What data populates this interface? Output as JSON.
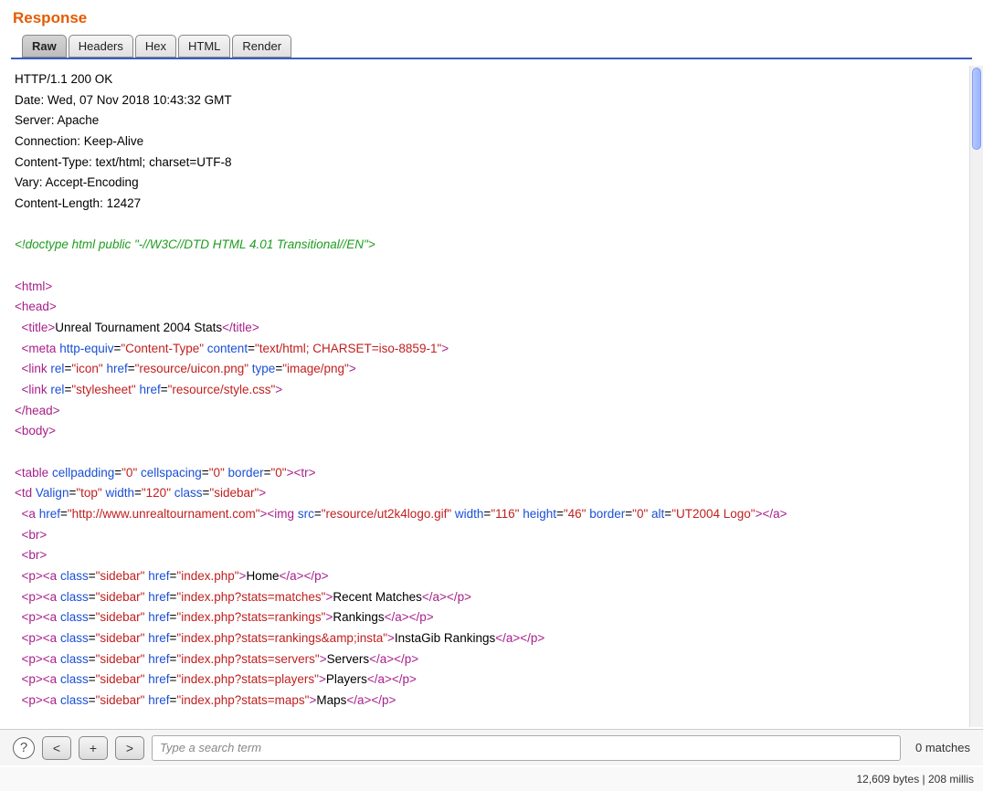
{
  "header": {
    "title": "Response"
  },
  "tabs": [
    {
      "label": "Raw",
      "active": true
    },
    {
      "label": "Headers",
      "active": false
    },
    {
      "label": "Hex",
      "active": false
    },
    {
      "label": "HTML",
      "active": false
    },
    {
      "label": "Render",
      "active": false
    }
  ],
  "http_headers": [
    "HTTP/1.1 200 OK",
    "Date: Wed, 07 Nov 2018 10:43:32 GMT",
    "Server: Apache",
    "Connection: Keep-Alive",
    "Content-Type: text/html; charset=UTF-8",
    "Vary: Accept-Encoding",
    "Content-Length: 12427"
  ],
  "doctype": "<!doctype html public \"-//W3C//DTD HTML 4.01 Transitional//EN\">",
  "body_tokens": [
    [
      {
        "c": "tg",
        "t": "<html>"
      }
    ],
    [
      {
        "c": "tg",
        "t": "<head>"
      }
    ],
    [
      {
        "c": "tx",
        "t": "  "
      },
      {
        "c": "tg",
        "t": "<title>"
      },
      {
        "c": "tx",
        "t": "Unreal Tournament 2004 Stats"
      },
      {
        "c": "tg",
        "t": "</title>"
      }
    ],
    [
      {
        "c": "tx",
        "t": "  "
      },
      {
        "c": "tg",
        "t": "<meta"
      },
      {
        "c": "tx",
        "t": " "
      },
      {
        "c": "at",
        "t": "http-equiv"
      },
      {
        "c": "tx",
        "t": "="
      },
      {
        "c": "av",
        "t": "\"Content-Type\""
      },
      {
        "c": "tx",
        "t": " "
      },
      {
        "c": "at",
        "t": "content"
      },
      {
        "c": "tx",
        "t": "="
      },
      {
        "c": "av",
        "t": "\"text/html; CHARSET=iso-8859-1\""
      },
      {
        "c": "tg",
        "t": ">"
      }
    ],
    [
      {
        "c": "tx",
        "t": "  "
      },
      {
        "c": "tg",
        "t": "<link"
      },
      {
        "c": "tx",
        "t": " "
      },
      {
        "c": "at",
        "t": "rel"
      },
      {
        "c": "tx",
        "t": "="
      },
      {
        "c": "av",
        "t": "\"icon\""
      },
      {
        "c": "tx",
        "t": " "
      },
      {
        "c": "at",
        "t": "href"
      },
      {
        "c": "tx",
        "t": "="
      },
      {
        "c": "av",
        "t": "\"resource/uicon.png\""
      },
      {
        "c": "tx",
        "t": " "
      },
      {
        "c": "at",
        "t": "type"
      },
      {
        "c": "tx",
        "t": "="
      },
      {
        "c": "av",
        "t": "\"image/png\""
      },
      {
        "c": "tg",
        "t": ">"
      }
    ],
    [
      {
        "c": "tx",
        "t": "  "
      },
      {
        "c": "tg",
        "t": "<link"
      },
      {
        "c": "tx",
        "t": " "
      },
      {
        "c": "at",
        "t": "rel"
      },
      {
        "c": "tx",
        "t": "="
      },
      {
        "c": "av",
        "t": "\"stylesheet\""
      },
      {
        "c": "tx",
        "t": " "
      },
      {
        "c": "at",
        "t": "href"
      },
      {
        "c": "tx",
        "t": "="
      },
      {
        "c": "av",
        "t": "\"resource/style.css\""
      },
      {
        "c": "tg",
        "t": ">"
      }
    ],
    [
      {
        "c": "tg",
        "t": "</head>"
      }
    ],
    [
      {
        "c": "tg",
        "t": "<body>"
      }
    ],
    [
      {
        "c": "tx",
        "t": ""
      }
    ],
    [
      {
        "c": "tg",
        "t": "<table"
      },
      {
        "c": "tx",
        "t": " "
      },
      {
        "c": "at",
        "t": "cellpadding"
      },
      {
        "c": "tx",
        "t": "="
      },
      {
        "c": "av",
        "t": "\"0\""
      },
      {
        "c": "tx",
        "t": " "
      },
      {
        "c": "at",
        "t": "cellspacing"
      },
      {
        "c": "tx",
        "t": "="
      },
      {
        "c": "av",
        "t": "\"0\""
      },
      {
        "c": "tx",
        "t": " "
      },
      {
        "c": "at",
        "t": "border"
      },
      {
        "c": "tx",
        "t": "="
      },
      {
        "c": "av",
        "t": "\"0\""
      },
      {
        "c": "tg",
        "t": "><tr>"
      }
    ],
    [
      {
        "c": "tg",
        "t": "<td"
      },
      {
        "c": "tx",
        "t": " "
      },
      {
        "c": "at",
        "t": "Valign"
      },
      {
        "c": "tx",
        "t": "="
      },
      {
        "c": "av",
        "t": "\"top\""
      },
      {
        "c": "tx",
        "t": " "
      },
      {
        "c": "at",
        "t": "width"
      },
      {
        "c": "tx",
        "t": "="
      },
      {
        "c": "av",
        "t": "\"120\""
      },
      {
        "c": "tx",
        "t": " "
      },
      {
        "c": "at",
        "t": "class"
      },
      {
        "c": "tx",
        "t": "="
      },
      {
        "c": "av",
        "t": "\"sidebar\""
      },
      {
        "c": "tg",
        "t": ">"
      }
    ],
    [
      {
        "c": "tx",
        "t": "  "
      },
      {
        "c": "tg",
        "t": "<a"
      },
      {
        "c": "tx",
        "t": " "
      },
      {
        "c": "at",
        "t": "href"
      },
      {
        "c": "tx",
        "t": "="
      },
      {
        "c": "av",
        "t": "\"http://www.unrealtournament.com\""
      },
      {
        "c": "tg",
        "t": "><img"
      },
      {
        "c": "tx",
        "t": " "
      },
      {
        "c": "at",
        "t": "src"
      },
      {
        "c": "tx",
        "t": "="
      },
      {
        "c": "av",
        "t": "\"resource/ut2k4logo.gif\""
      },
      {
        "c": "tx",
        "t": " "
      },
      {
        "c": "at",
        "t": "width"
      },
      {
        "c": "tx",
        "t": "="
      },
      {
        "c": "av",
        "t": "\"116\""
      },
      {
        "c": "tx",
        "t": " "
      },
      {
        "c": "at",
        "t": "height"
      },
      {
        "c": "tx",
        "t": "="
      },
      {
        "c": "av",
        "t": "\"46\""
      },
      {
        "c": "tx",
        "t": " "
      },
      {
        "c": "at",
        "t": "border"
      },
      {
        "c": "tx",
        "t": "="
      },
      {
        "c": "av",
        "t": "\"0\""
      },
      {
        "c": "tx",
        "t": " "
      },
      {
        "c": "at",
        "t": "alt"
      },
      {
        "c": "tx",
        "t": "="
      },
      {
        "c": "av",
        "t": "\"UT2004 Logo\""
      },
      {
        "c": "tg",
        "t": "></a>"
      }
    ],
    [
      {
        "c": "tx",
        "t": "  "
      },
      {
        "c": "tg",
        "t": "<br>"
      }
    ],
    [
      {
        "c": "tx",
        "t": "  "
      },
      {
        "c": "tg",
        "t": "<br>"
      }
    ],
    [
      {
        "c": "tx",
        "t": "  "
      },
      {
        "c": "tg",
        "t": "<p><a"
      },
      {
        "c": "tx",
        "t": " "
      },
      {
        "c": "at",
        "t": "class"
      },
      {
        "c": "tx",
        "t": "="
      },
      {
        "c": "av",
        "t": "\"sidebar\""
      },
      {
        "c": "tx",
        "t": " "
      },
      {
        "c": "at",
        "t": "href"
      },
      {
        "c": "tx",
        "t": "="
      },
      {
        "c": "av",
        "t": "\"index.php\""
      },
      {
        "c": "tg",
        "t": ">"
      },
      {
        "c": "tx",
        "t": "Home"
      },
      {
        "c": "tg",
        "t": "</a></p>"
      }
    ],
    [
      {
        "c": "tx",
        "t": "  "
      },
      {
        "c": "tg",
        "t": "<p><a"
      },
      {
        "c": "tx",
        "t": " "
      },
      {
        "c": "at",
        "t": "class"
      },
      {
        "c": "tx",
        "t": "="
      },
      {
        "c": "av",
        "t": "\"sidebar\""
      },
      {
        "c": "tx",
        "t": " "
      },
      {
        "c": "at",
        "t": "href"
      },
      {
        "c": "tx",
        "t": "="
      },
      {
        "c": "av",
        "t": "\"index.php?stats=matches\""
      },
      {
        "c": "tg",
        "t": ">"
      },
      {
        "c": "tx",
        "t": "Recent Matches"
      },
      {
        "c": "tg",
        "t": "</a></p>"
      }
    ],
    [
      {
        "c": "tx",
        "t": "  "
      },
      {
        "c": "tg",
        "t": "<p><a"
      },
      {
        "c": "tx",
        "t": " "
      },
      {
        "c": "at",
        "t": "class"
      },
      {
        "c": "tx",
        "t": "="
      },
      {
        "c": "av",
        "t": "\"sidebar\""
      },
      {
        "c": "tx",
        "t": " "
      },
      {
        "c": "at",
        "t": "href"
      },
      {
        "c": "tx",
        "t": "="
      },
      {
        "c": "av",
        "t": "\"index.php?stats=rankings\""
      },
      {
        "c": "tg",
        "t": ">"
      },
      {
        "c": "tx",
        "t": "Rankings"
      },
      {
        "c": "tg",
        "t": "</a></p>"
      }
    ],
    [
      {
        "c": "tx",
        "t": "  "
      },
      {
        "c": "tg",
        "t": "<p><a"
      },
      {
        "c": "tx",
        "t": " "
      },
      {
        "c": "at",
        "t": "class"
      },
      {
        "c": "tx",
        "t": "="
      },
      {
        "c": "av",
        "t": "\"sidebar\""
      },
      {
        "c": "tx",
        "t": " "
      },
      {
        "c": "at",
        "t": "href"
      },
      {
        "c": "tx",
        "t": "="
      },
      {
        "c": "av",
        "t": "\"index.php?stats=rankings&amp;insta\""
      },
      {
        "c": "tg",
        "t": ">"
      },
      {
        "c": "tx",
        "t": "InstaGib Rankings"
      },
      {
        "c": "tg",
        "t": "</a></p>"
      }
    ],
    [
      {
        "c": "tx",
        "t": "  "
      },
      {
        "c": "tg",
        "t": "<p><a"
      },
      {
        "c": "tx",
        "t": " "
      },
      {
        "c": "at",
        "t": "class"
      },
      {
        "c": "tx",
        "t": "="
      },
      {
        "c": "av",
        "t": "\"sidebar\""
      },
      {
        "c": "tx",
        "t": " "
      },
      {
        "c": "at",
        "t": "href"
      },
      {
        "c": "tx",
        "t": "="
      },
      {
        "c": "av",
        "t": "\"index.php?stats=servers\""
      },
      {
        "c": "tg",
        "t": ">"
      },
      {
        "c": "tx",
        "t": "Servers"
      },
      {
        "c": "tg",
        "t": "</a></p>"
      }
    ],
    [
      {
        "c": "tx",
        "t": "  "
      },
      {
        "c": "tg",
        "t": "<p><a"
      },
      {
        "c": "tx",
        "t": " "
      },
      {
        "c": "at",
        "t": "class"
      },
      {
        "c": "tx",
        "t": "="
      },
      {
        "c": "av",
        "t": "\"sidebar\""
      },
      {
        "c": "tx",
        "t": " "
      },
      {
        "c": "at",
        "t": "href"
      },
      {
        "c": "tx",
        "t": "="
      },
      {
        "c": "av",
        "t": "\"index.php?stats=players\""
      },
      {
        "c": "tg",
        "t": ">"
      },
      {
        "c": "tx",
        "t": "Players"
      },
      {
        "c": "tg",
        "t": "</a></p>"
      }
    ],
    [
      {
        "c": "tx",
        "t": "  "
      },
      {
        "c": "tg",
        "t": "<p><a"
      },
      {
        "c": "tx",
        "t": " "
      },
      {
        "c": "at",
        "t": "class"
      },
      {
        "c": "tx",
        "t": "="
      },
      {
        "c": "av",
        "t": "\"sidebar\""
      },
      {
        "c": "tx",
        "t": " "
      },
      {
        "c": "at",
        "t": "href"
      },
      {
        "c": "tx",
        "t": "="
      },
      {
        "c": "av",
        "t": "\"index.php?stats=maps\""
      },
      {
        "c": "tg",
        "t": ">"
      },
      {
        "c": "tx",
        "t": "Maps"
      },
      {
        "c": "tg",
        "t": "</a></p>"
      }
    ]
  ],
  "footer": {
    "help": "?",
    "prev": "<",
    "add": "+",
    "next": ">",
    "search_placeholder": "Type a search term",
    "matches": "0 matches"
  },
  "status": {
    "text": "12,609 bytes | 208 millis"
  }
}
